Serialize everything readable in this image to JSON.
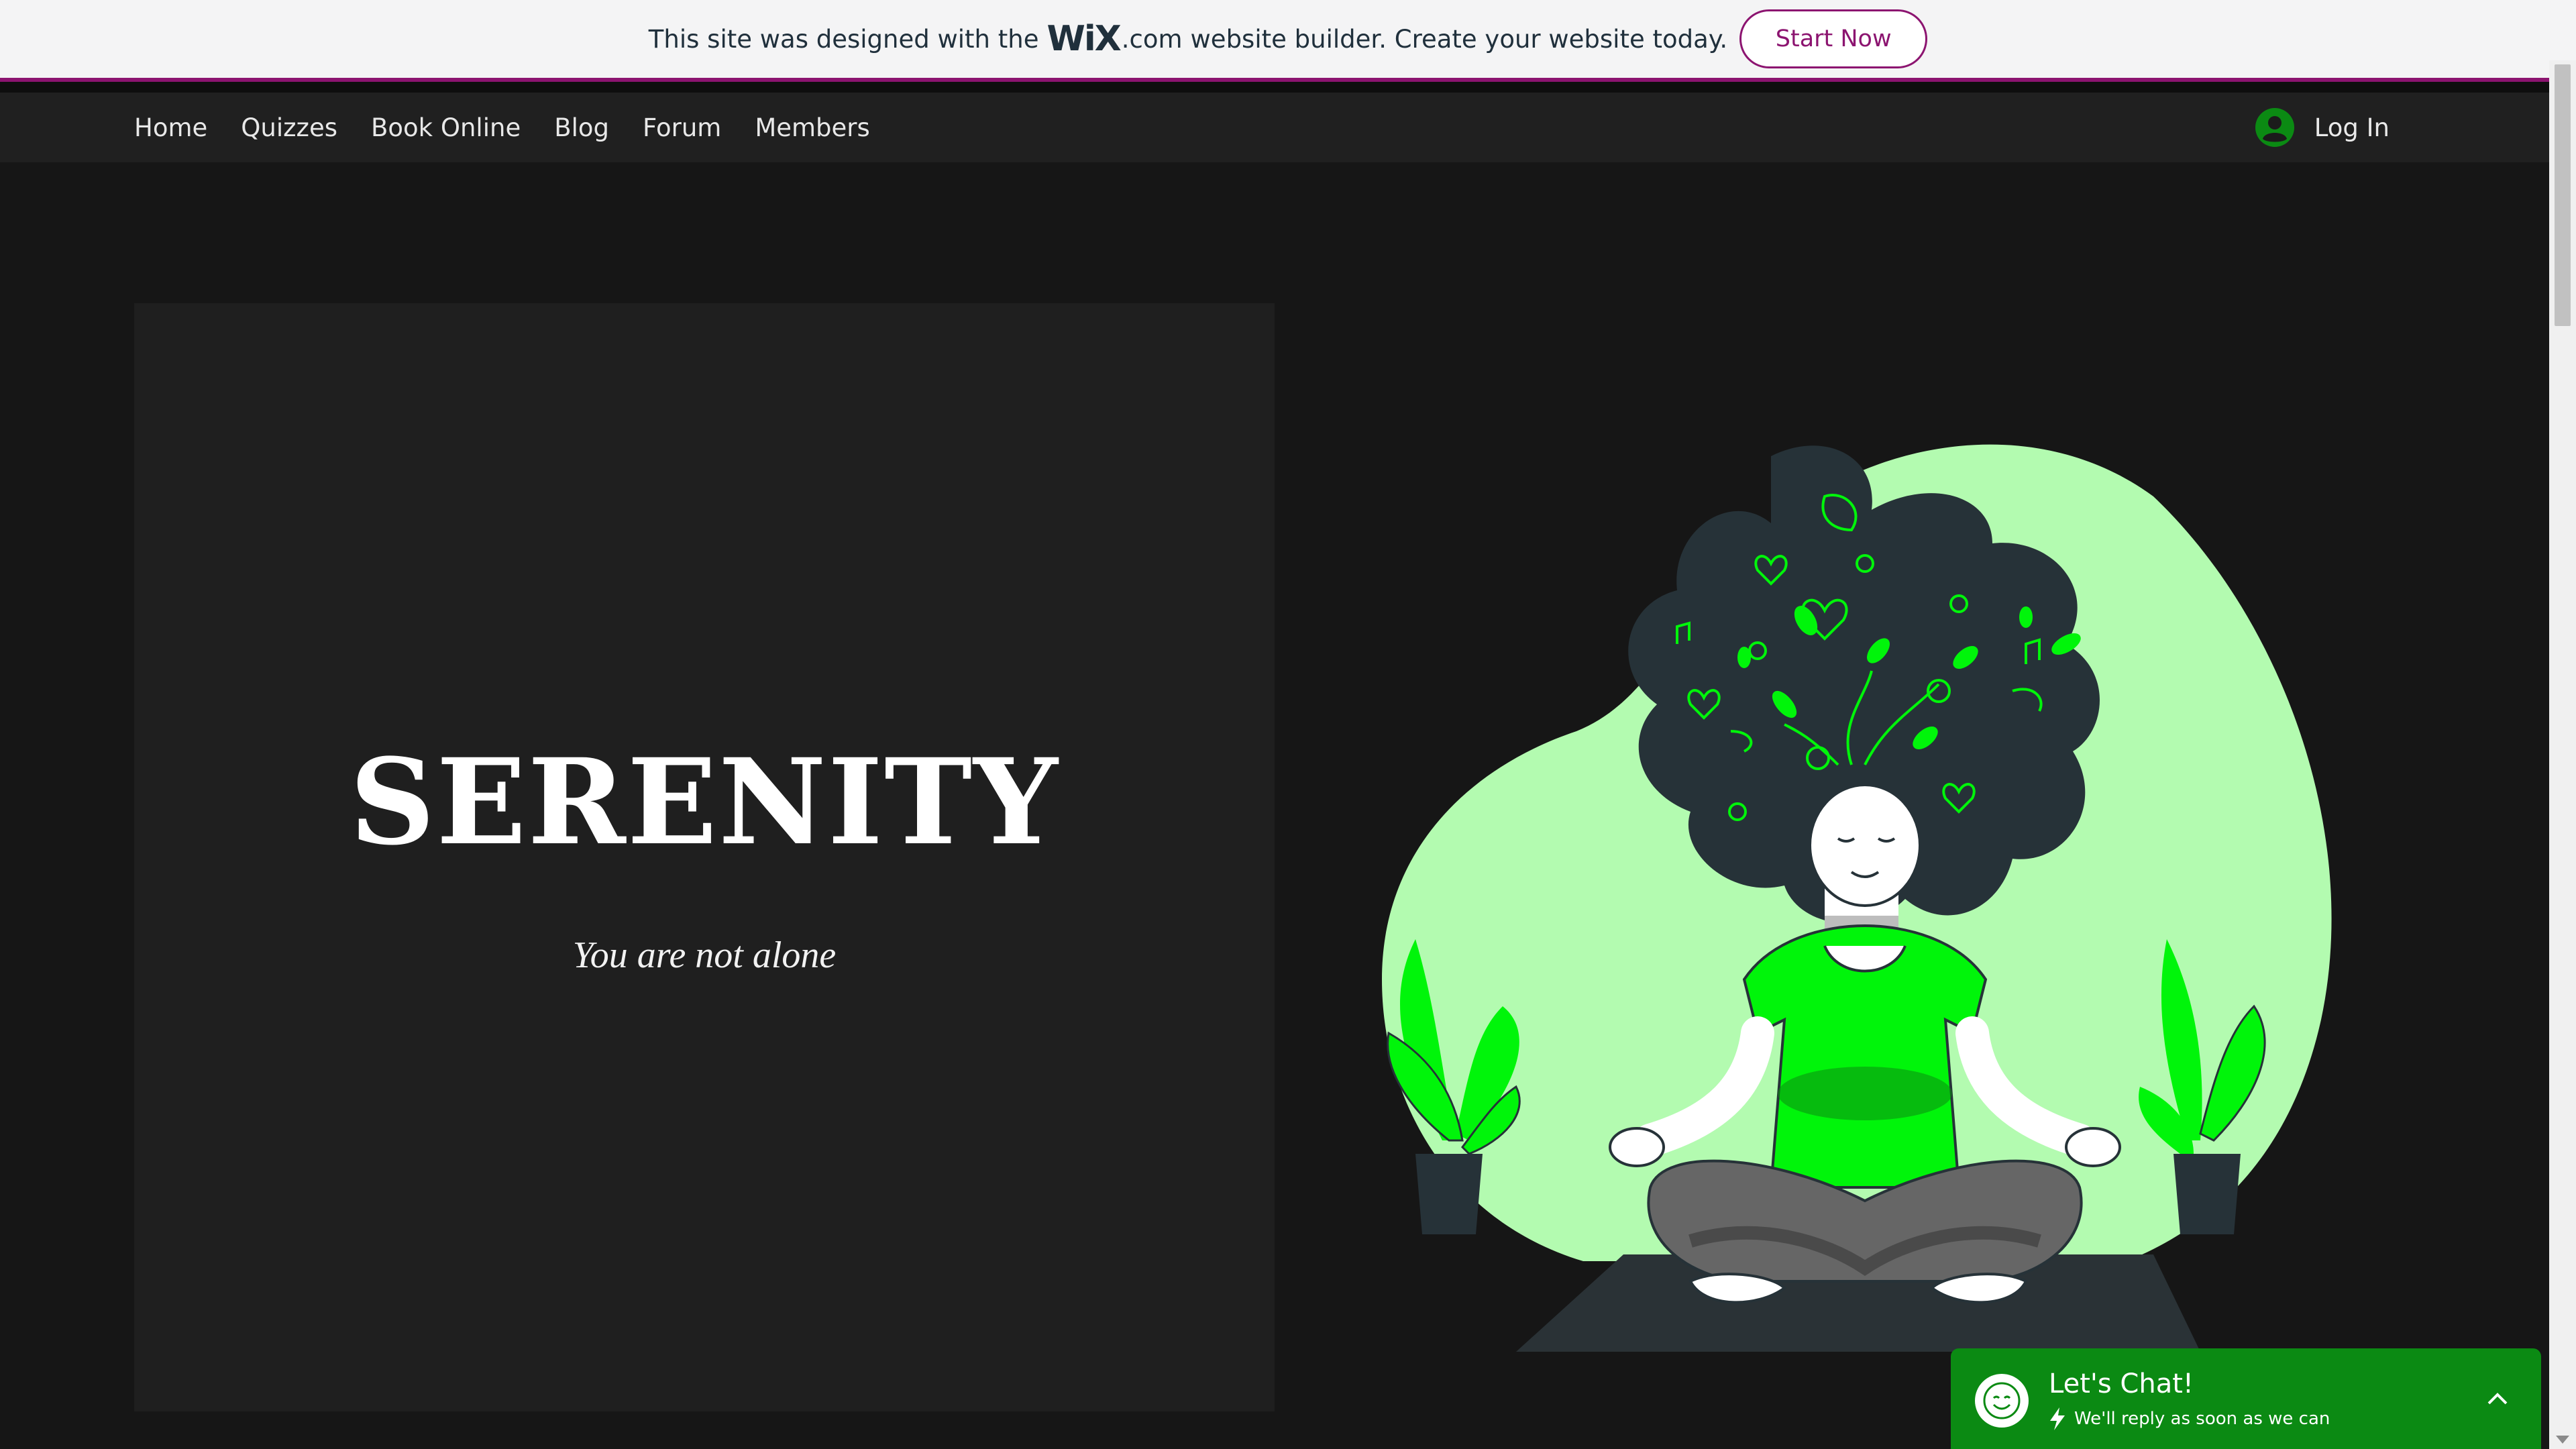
{
  "banner": {
    "prefix": "This site was designed with the",
    "logo": "WiX",
    "dotcom": ".com",
    "suffix": "website builder. Create your website today.",
    "cta": "Start Now"
  },
  "nav": {
    "items": [
      {
        "label": "Home"
      },
      {
        "label": "Quizzes"
      },
      {
        "label": "Book Online"
      },
      {
        "label": "Blog"
      },
      {
        "label": "Forum"
      },
      {
        "label": "Members"
      }
    ],
    "login": "Log In",
    "login_icon": "user-avatar-icon"
  },
  "hero": {
    "title": "SERENITY",
    "subtitle": "You are not alone"
  },
  "chat": {
    "title": "Let's Chat!",
    "subtitle": "We'll reply as soon as we can",
    "icon": "smile-icon"
  },
  "colors": {
    "accent": "#8c1470",
    "chat_green": "#0b8a13",
    "neon_green": "#00f50a",
    "light_green": "#b3fbb0"
  }
}
